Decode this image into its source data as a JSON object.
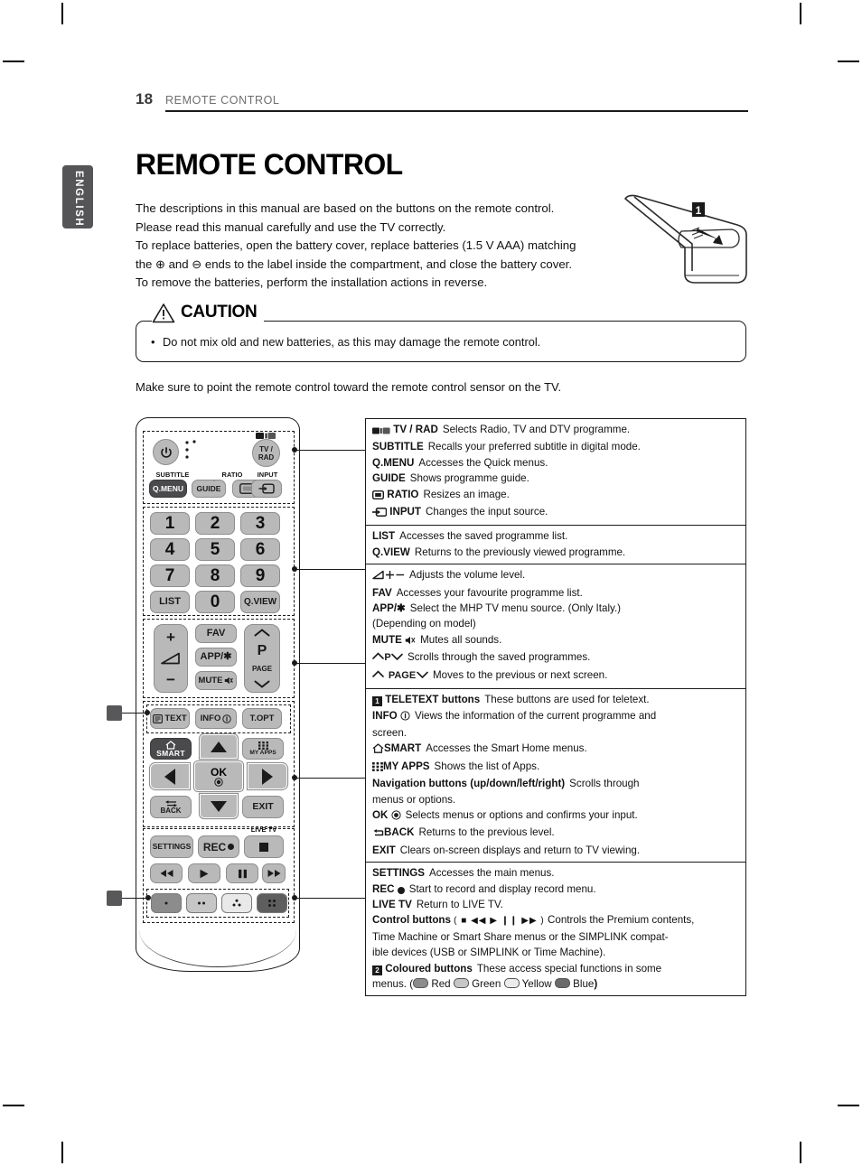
{
  "page": {
    "number": "18",
    "header_title": "REMOTE CONTROL",
    "language_tab": "ENGLISH",
    "main_title": "REMOTE CONTROL"
  },
  "intro": {
    "line1": "The descriptions in this manual are based on the buttons on the remote control.",
    "line2": "Please read this manual carefully and use the TV correctly.",
    "line3": "To replace batteries, open the battery cover, replace batteries (1.5 V AAA) matching",
    "line4_a": "the",
    "line4_plus": "⊕",
    "line4_b": "and",
    "line4_minus": "⊖",
    "line4_c": "ends to the label inside the compartment, and close the battery cover.",
    "line5": "To remove the batteries, perform the installation actions in reverse."
  },
  "caution": {
    "label": "CAUTION",
    "bullet": "•",
    "text": "Do not mix old and new batteries, as this may damage the remote control."
  },
  "note": "Make sure to point the remote control toward the remote control sensor on the TV.",
  "remote_photo": {
    "callout": "1"
  },
  "callouts": {
    "one": "1",
    "two": "2"
  },
  "remote": {
    "power_label": "⏻",
    "tvrad": "TV /\nRAD",
    "tvrad_line1": "TV /",
    "tvrad_line2": "RAD",
    "subtitle_label": "SUBTITLE",
    "ratio_label": "RATIO",
    "input_label": "INPUT",
    "qmenu": "Q.MENU",
    "guide": "GUIDE",
    "keys": [
      "1",
      "2",
      "3",
      "4",
      "5",
      "6",
      "7",
      "8",
      "9"
    ],
    "list": "LIST",
    "zero": "0",
    "qview": "Q.VIEW",
    "vol_plus": "+",
    "vol_minus": "−",
    "fav": "FAV",
    "app": "APP/✱",
    "mute": "MUTE",
    "p_letter": "P",
    "page_label": "PAGE",
    "text": "TEXT",
    "info": "INFO",
    "topt": "T.OPT",
    "smart": "SMART",
    "myapps": "MY APPS",
    "ok": "OK",
    "back": "BACK",
    "exit": "EXIT",
    "livetv_label": "LIVE TV",
    "settings": "SETTINGS",
    "rec": "REC"
  },
  "descriptions": [
    {
      "id": "section-top",
      "lines": [
        {
          "icon": "tv-rad-icon",
          "bold": "TV / RAD",
          "text": "Selects Radio, TV and DTV programme."
        },
        {
          "bold": "SUBTITLE",
          "text": "Recalls your preferred subtitle in digital mode."
        },
        {
          "bold": "Q.MENU",
          "text": "Accesses the Quick menus."
        },
        {
          "bold": "GUIDE",
          "text": "Shows programme guide."
        },
        {
          "icon": "ratio-icon",
          "bold": "RATIO",
          "text": "Resizes an image."
        },
        {
          "icon": "input-icon",
          "bold": "INPUT",
          "text": "Changes the input source."
        }
      ]
    },
    {
      "id": "section-list",
      "lines": [
        {
          "bold": "LIST",
          "text": "Accesses the saved  programme list."
        },
        {
          "bold": "Q.VIEW",
          "text": "Returns to the previously viewed programme."
        }
      ]
    },
    {
      "id": "section-volume",
      "lines": [
        {
          "icon": "volume-plus-minus-icon",
          "bold": "",
          "text": "Adjusts the volume level."
        },
        {
          "bold": "FAV",
          "text": "Accesses your favourite programme list."
        },
        {
          "bold": "APP/✱",
          "text": "Select the MHP TV menu source. (Only Italy.)"
        },
        {
          "bold": "",
          "text": "(Depending on model)"
        },
        {
          "bold": "MUTE",
          "icon_after": "mute-icon",
          "text": "Mutes all sounds."
        },
        {
          "icon": "p-updown-icon",
          "bold": "",
          "text": "Scrolls through the saved programmes."
        },
        {
          "icon": "page-updown-icon",
          "bold": "",
          "text": "Moves to the previous or next screen."
        }
      ]
    },
    {
      "id": "section-navigation",
      "lines": [
        {
          "badge": "1",
          "bold": "TELETEXT buttons",
          "text": "These buttons are used for teletext."
        },
        {
          "bold": "INFO",
          "icon_after": "info-circle-icon",
          "text": "Views the information of the current programme and"
        },
        {
          "bold": "",
          "text": "screen."
        },
        {
          "icon": "home-icon",
          "bold": "SMART",
          "text": "Accesses the Smart Home menus."
        },
        {
          "icon": "grid-icon",
          "bold": "MY APPS",
          "text": "Shows the list of Apps."
        },
        {
          "bold": "Navigation buttons (up/down/left/right)",
          "text": "Scrolls through"
        },
        {
          "bold": "",
          "text": "menus or options."
        },
        {
          "bold": "OK",
          "icon_after": "ok-circle-icon",
          "text": "Selects menus or options and confirms your input."
        },
        {
          "icon": "back-arrow-icon",
          "bold": "BACK",
          "text": "Returns to the previous level."
        },
        {
          "bold": "EXIT",
          "text": "Clears on-screen displays and return to TV viewing."
        }
      ]
    },
    {
      "id": "section-settings",
      "lines": [
        {
          "bold": "SETTINGS",
          "text": "Accesses the main menus."
        },
        {
          "bold": "REC",
          "icon_after": "record-dot-icon",
          "text": "Start to record and display record menu."
        },
        {
          "bold": "LIVE TV",
          "text": "Return to LIVE TV."
        },
        {
          "bold": "Control buttons",
          "icons": "( ■ ◀◀ ▶ ❙❙ ▶▶ )",
          "text": "Controls the Premium contents,"
        },
        {
          "bold": "",
          "text": "Time Machine or Smart Share menus or the SIMPLINK compat-"
        },
        {
          "bold": "",
          "text": "ible devices (USB or SIMPLINK or Time Machine)."
        },
        {
          "badge": "2",
          "bold": "Coloured buttons",
          "text": "These access special functions in some"
        },
        {
          "bold": "",
          "text": "menus. (",
          "colours": [
            "Red",
            "Green",
            "Yellow",
            "Blue"
          ]
        }
      ]
    }
  ]
}
